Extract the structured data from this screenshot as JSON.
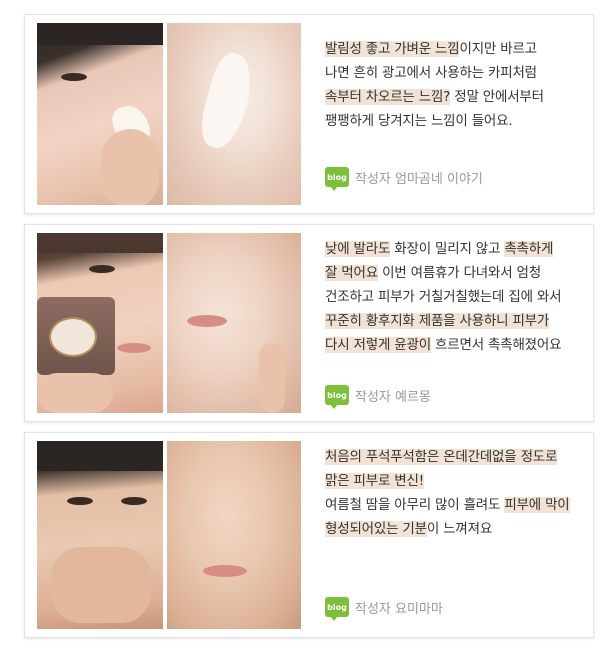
{
  "blog_badge": "blog",
  "colors": {
    "highlight": "#f3e3d4",
    "blog_green": "#7bbf3a"
  },
  "reviews": [
    {
      "lines": [
        [
          {
            "t": "발림성 좋고 가벼운 느낌",
            "hl": true
          },
          {
            "t": "이지만 바르고",
            "hl": false
          }
        ],
        [
          {
            "t": "나면 흔히 광고에서 사용하는 카피처럼",
            "hl": false
          }
        ],
        [
          {
            "t": "속부터 차오르는 느낌?",
            "hl": true
          },
          {
            "t": " 정말 안에서부터",
            "hl": false
          }
        ],
        [
          {
            "t": "팽팽하게 당겨지는 느낌이 들어요.",
            "hl": false
          }
        ]
      ],
      "author": "작성자 엄마곰네 이야기"
    },
    {
      "lines": [
        [
          {
            "t": "낮에 발라도",
            "hl": true
          },
          {
            "t": " 화장이 밀리지 않고 ",
            "hl": false
          },
          {
            "t": "촉촉하게",
            "hl": true
          }
        ],
        [
          {
            "t": "잘 먹어요",
            "hl": true
          },
          {
            "t": " 이번 여름휴가 다녀와서  엄청",
            "hl": false
          }
        ],
        [
          {
            "t": "건조하고 피부가 거칠거칠했는데 집에 와서",
            "hl": false
          }
        ],
        [
          {
            "t": "꾸준히 황후지화 제품을 사용하니 피부가",
            "hl": true
          }
        ],
        [
          {
            "t": "다시 저렇게 윤광이",
            "hl": true
          },
          {
            "t": " 흐르면서 촉촉해졌어요",
            "hl": false
          }
        ]
      ],
      "author": "작성자 예르몽"
    },
    {
      "lines": [
        [
          {
            "t": "처음의 푸석푸석함은 온데간데없을 정도로",
            "hl": true
          }
        ],
        [
          {
            "t": "맑은 피부로 변신!",
            "hl": true
          }
        ],
        [
          {
            "t": "여름철 땀을 아무리 많이 흘려도 ",
            "hl": false
          },
          {
            "t": "피부에 막이",
            "hl": true
          }
        ],
        [
          {
            "t": "형성되어있는 기분",
            "hl": true
          },
          {
            "t": "이 느껴져요",
            "hl": false
          }
        ]
      ],
      "author": "작성자 요미마마"
    }
  ]
}
